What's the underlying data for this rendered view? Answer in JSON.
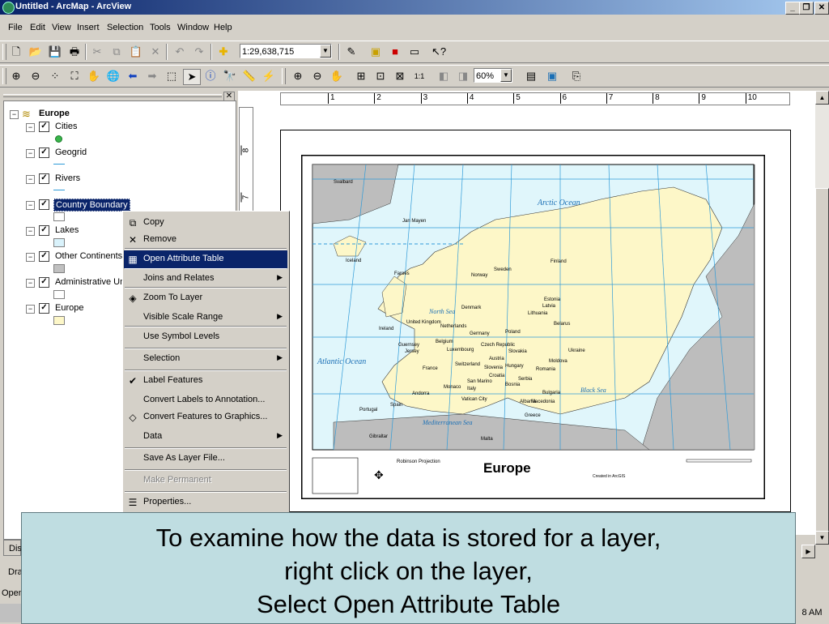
{
  "window": {
    "title": "Untitled - ArcMap - ArcView"
  },
  "menubar": {
    "items": [
      "File",
      "Edit",
      "View",
      "Insert",
      "Selection",
      "Tools",
      "Window",
      "Help"
    ]
  },
  "toolbar_standard": {
    "scale_value": "1:29,638,715"
  },
  "toolbar_tools": {
    "zoom_value": "60%"
  },
  "toc": {
    "root": "Europe",
    "layers": [
      {
        "name": "Cities",
        "symbol": "point",
        "color": "#39b54a"
      },
      {
        "name": "Geogrid",
        "symbol": "line",
        "color": "#2f9bd8"
      },
      {
        "name": "Rivers",
        "symbol": "line",
        "color": "#2f9bd8"
      },
      {
        "name": "Country Boundary",
        "symbol": "fill",
        "color": "#ffffff",
        "selected": true
      },
      {
        "name": "Lakes",
        "symbol": "fill",
        "color": "#d9f2fb"
      },
      {
        "name": "Other Continents",
        "symbol": "fill",
        "color": "#c0c0c0"
      },
      {
        "name": "Administrative Un",
        "symbol": "fill",
        "color": "#ffffff"
      },
      {
        "name": "Europe",
        "symbol": "fill",
        "color": "#fdf7c8"
      }
    ]
  },
  "context_menu": {
    "items": [
      {
        "label": "Copy",
        "icon": "copy-icon"
      },
      {
        "label": "Remove",
        "icon": "remove-icon"
      },
      {
        "label": "Open Attribute Table",
        "icon": "table-icon",
        "highlighted": true
      },
      {
        "label": "Joins and Relates",
        "submenu": true
      },
      {
        "label": "Zoom To Layer",
        "icon": "zoom-to-layer-icon"
      },
      {
        "label": "Visible Scale Range",
        "submenu": true
      },
      {
        "label": "Use Symbol Levels"
      },
      {
        "label": "Selection",
        "submenu": true
      },
      {
        "label": "Label Features",
        "checked": true
      },
      {
        "label": "Convert Labels to Annotation..."
      },
      {
        "label": "Convert Features to Graphics...",
        "icon": "convert-graphics-icon"
      },
      {
        "label": "Data",
        "submenu": true
      },
      {
        "label": "Save As Layer File..."
      },
      {
        "label": "Make Permanent",
        "disabled": true
      },
      {
        "label": "Properties...",
        "icon": "properties-icon"
      }
    ]
  },
  "ruler_h": {
    "ticks": [
      "1",
      "2",
      "3",
      "4",
      "5",
      "6",
      "7",
      "8",
      "9",
      "10"
    ]
  },
  "ruler_v": {
    "ticks": [
      "8",
      "7"
    ]
  },
  "map": {
    "title": "Europe",
    "ocean_labels": [
      "Arctic Ocean",
      "Atlantic Ocean",
      "North Sea",
      "Mediterranean Sea",
      "Black Sea"
    ],
    "country_labels": [
      "Jan Mayen",
      "Faroes",
      "Iceland",
      "Ireland",
      "United Kingdom",
      "Norway",
      "Sweden",
      "Finland",
      "Denmark",
      "Estonia",
      "Latvia",
      "Lithuania",
      "Belarus",
      "Poland",
      "Germany",
      "Netherlands",
      "Belgium",
      "Luxembourg",
      "France",
      "Switzerland",
      "Austria",
      "Czech Republic",
      "Slovakia",
      "Hungary",
      "Romania",
      "Ukraine",
      "Moldova",
      "Bulgaria",
      "Serbia",
      "Croatia",
      "Bosnia",
      "Italy",
      "San Marino",
      "Vatican City",
      "Monaco",
      "Andorra",
      "Spain",
      "Portugal",
      "Gibraltar",
      "Malta",
      "Albania",
      "Greece",
      "Macedonia",
      "Slovenia",
      "Svalbard",
      "Jersey",
      "Guernsey"
    ],
    "projection": "Robinson Projection",
    "credits": "Created in ArcGIS"
  },
  "statusbar": {
    "time": "8 AM",
    "left_text": "Open",
    "tab_dis": "Dis",
    "tab_dra": "Dra"
  },
  "caption": {
    "lines": [
      "To examine how the data is stored for a layer,",
      "right click on the layer,",
      "Select Open Attribute Table"
    ]
  }
}
